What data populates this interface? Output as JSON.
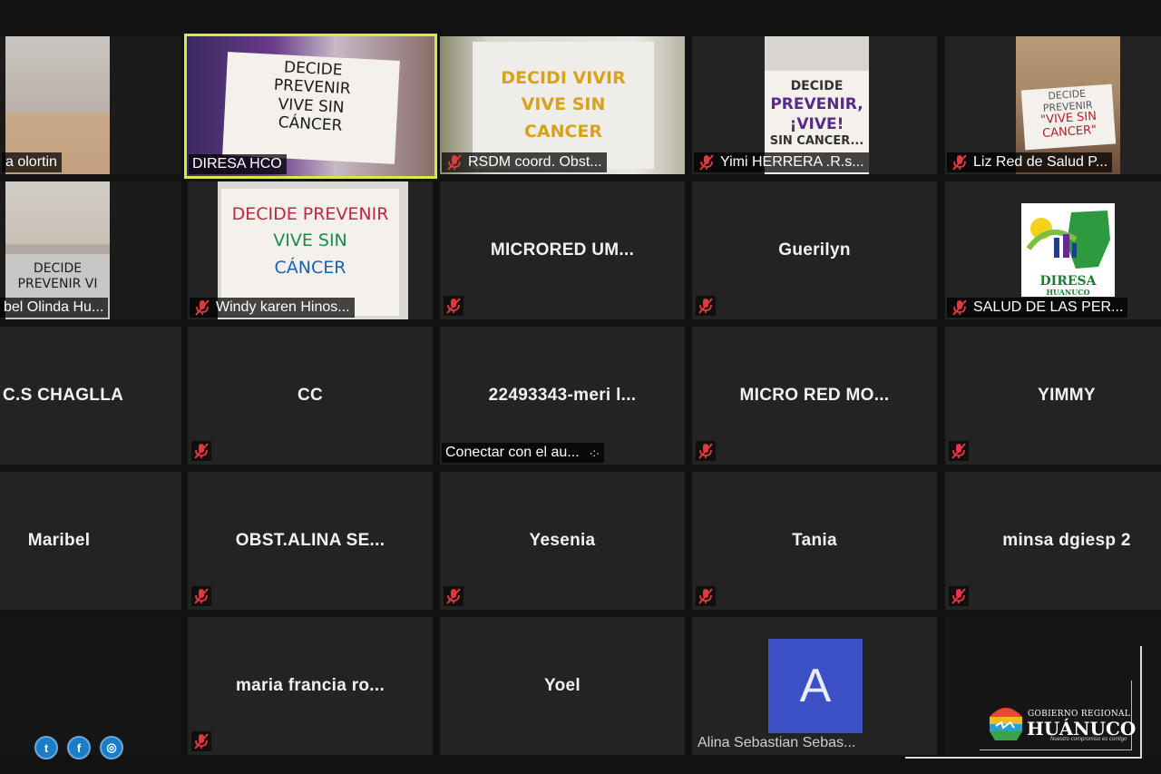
{
  "participants": {
    "p1": {
      "name": "a olortin"
    },
    "p2": {
      "name": "DIRESA HCO",
      "sign": [
        "DECIDE",
        "PREVENIR",
        "VIVE SIN",
        "CÁNCER"
      ]
    },
    "p3": {
      "name": "RSDM coord. Obst...",
      "sign": [
        "DECIDI VIVIR",
        "VIVE SIN",
        "CANCER"
      ]
    },
    "p4": {
      "name": "Yimi HERRERA .R.s...",
      "sign": [
        "DECIDE",
        "PREVENIR,",
        "¡VIVE!",
        "SIN CANCER..."
      ]
    },
    "p5": {
      "name": "Liz Red de Salud P...",
      "sign": [
        "DECIDE",
        "PREVENIR",
        "\"VIVE SIN",
        "CANCER\""
      ]
    },
    "p6": {
      "name": "bel Olinda Hu...",
      "sign": [
        "DECIDE",
        "PREVENIR VI"
      ]
    },
    "p7": {
      "name": "Windy karen Hinos...",
      "sign": [
        "DECIDE PREVENIR",
        "VIVE SIN",
        "CÁNCER"
      ]
    },
    "p8": {
      "name": "MICRORED UM..."
    },
    "p9": {
      "name": "Guerilyn"
    },
    "p10": {
      "name": "SALUD DE LAS PER...",
      "logo_text": [
        "DIRESA",
        "HUANUCO"
      ]
    },
    "p11": {
      "name": "C.S CHAGLLA"
    },
    "p12": {
      "name": "CC"
    },
    "p13": {
      "name": "22493343-meri l...",
      "status": "Conectar con el au..."
    },
    "p14": {
      "name": "MICRO RED MO..."
    },
    "p15": {
      "name": "YIMMY"
    },
    "p16": {
      "name": "Maribel"
    },
    "p17": {
      "name": "OBST.ALINA SE..."
    },
    "p18": {
      "name": "Yesenia"
    },
    "p19": {
      "name": "Tania"
    },
    "p20": {
      "name": "minsa dgiesp 2"
    },
    "p21": {
      "name": "maria francia ro..."
    },
    "p22": {
      "name": "Yoel"
    },
    "p23": {
      "name": "Alina Sebastian Sebas...",
      "avatar_letter": "A"
    }
  },
  "overlay": {
    "logo_title": "GOBIERNO REGIONAL",
    "logo_name": "HUÁNUCO",
    "logo_tagline": "Nuestro compromiso es contigo",
    "social": {
      "twitter": "t",
      "facebook": "f",
      "instagram": "◎"
    }
  },
  "colors": {
    "active_border": "#d7e84a",
    "tile": "#232323",
    "mute_red": "#e0393e",
    "avatar": "#3a50c4"
  }
}
